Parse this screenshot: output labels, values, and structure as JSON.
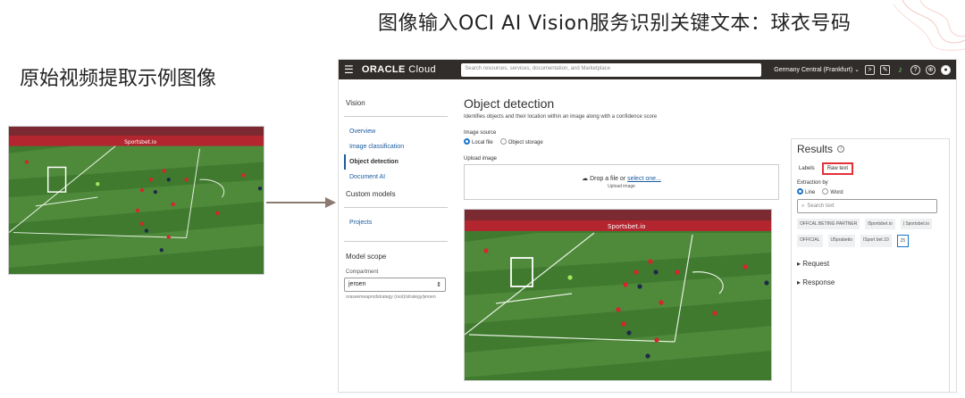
{
  "slide": {
    "title": "图像输入OCI AI Vision服务识别关键文本：球衣号码",
    "left_heading": "原始视频提取示例图像"
  },
  "console": {
    "topbar": {
      "logo_main": "ORACLE",
      "logo_suffix": " Cloud",
      "search_placeholder": "Search resources, services, documentation, and Marketplace",
      "region": "Germany Central (Frankfurt)",
      "icons": [
        "terminal-icon",
        "edit-icon",
        "bell-icon",
        "help-icon",
        "globe-icon",
        "user-icon"
      ]
    },
    "sidenav": {
      "title": "Vision",
      "items": [
        {
          "label": "Overview",
          "active": false
        },
        {
          "label": "Image classification",
          "active": false
        },
        {
          "label": "Object detection",
          "active": true
        },
        {
          "label": "Document AI",
          "active": false
        }
      ],
      "custom_models": "Custom models",
      "projects": "Projects",
      "model_scope": "Model scope",
      "compartment_label": "Compartment",
      "compartment_value": "jeroen",
      "compartment_path": "oraseemeaprodstrategy (root)/strategy/jeroen"
    },
    "main": {
      "title": "Object detection",
      "description": "Identifies objects and their location within an image along with a confidence score",
      "image_source_label": "Image source",
      "source_local": "Local file",
      "source_object": "Object storage",
      "upload_label": "Upload image",
      "drop_text": "Drop a file or ",
      "drop_link": "select one...",
      "drop_sub": "Upload image"
    },
    "results": {
      "title": "Results",
      "tab_labels": "Labels",
      "tab_raw": "Raw text",
      "extraction_label": "Extraction by",
      "opt_line": "Line",
      "opt_word": "Word",
      "search_placeholder": "Search text",
      "chips": [
        "OFFCAL BETING PARTNER",
        "l5portsbet.io",
        "| Sportsbet.io",
        "OFFICIAL",
        "U5prabetio",
        "ISport bet.10",
        "25"
      ],
      "request": "Request",
      "response": "Response"
    }
  },
  "pitch": {
    "grass_light": "#4e8a3a",
    "grass_dark": "#3f7a2f",
    "banner_text": "Sportsbet.io",
    "jersey_number": "25"
  }
}
